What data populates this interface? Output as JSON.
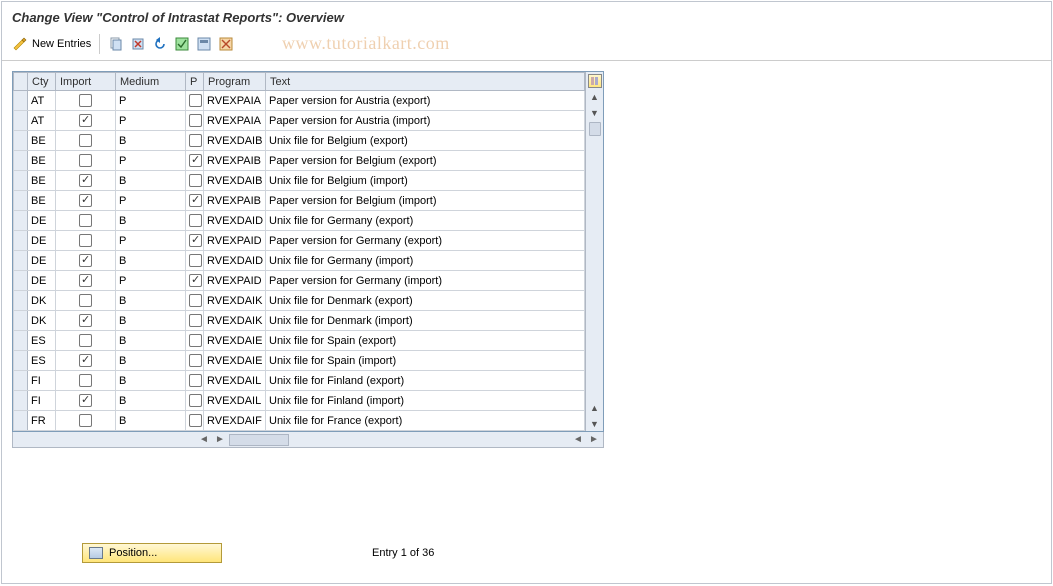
{
  "title": "Change View \"Control of Intrastat Reports\": Overview",
  "watermark": "www.tutorialkart.com",
  "toolbar": {
    "new_entries_label": "New Entries"
  },
  "columns": {
    "cty": "Cty",
    "import": "Import",
    "medium": "Medium",
    "p": "P",
    "program": "Program",
    "text": "Text"
  },
  "rows": [
    {
      "cty": "AT",
      "import": false,
      "medium": "P",
      "p": false,
      "program": "RVEXPAIA",
      "text": "Paper version for Austria (export)"
    },
    {
      "cty": "AT",
      "import": true,
      "medium": "P",
      "p": false,
      "program": "RVEXPAIA",
      "text": "Paper version for Austria (import)"
    },
    {
      "cty": "BE",
      "import": false,
      "medium": "B",
      "p": false,
      "program": "RVEXDAIB",
      "text": "Unix file for Belgium (export)"
    },
    {
      "cty": "BE",
      "import": false,
      "medium": "P",
      "p": true,
      "program": "RVEXPAIB",
      "text": "Paper version for Belgium (export)"
    },
    {
      "cty": "BE",
      "import": true,
      "medium": "B",
      "p": false,
      "program": "RVEXDAIB",
      "text": "Unix file for Belgium (import)"
    },
    {
      "cty": "BE",
      "import": true,
      "medium": "P",
      "p": true,
      "program": "RVEXPAIB",
      "text": "Paper version for Belgium (import)"
    },
    {
      "cty": "DE",
      "import": false,
      "medium": "B",
      "p": false,
      "program": "RVEXDAID",
      "text": "Unix file for Germany (export)"
    },
    {
      "cty": "DE",
      "import": false,
      "medium": "P",
      "p": true,
      "program": "RVEXPAID",
      "text": "Paper version for Germany (export)"
    },
    {
      "cty": "DE",
      "import": true,
      "medium": "B",
      "p": false,
      "program": "RVEXDAID",
      "text": "Unix file for Germany (import)"
    },
    {
      "cty": "DE",
      "import": true,
      "medium": "P",
      "p": true,
      "program": "RVEXPAID",
      "text": "Paper version for Germany (import)"
    },
    {
      "cty": "DK",
      "import": false,
      "medium": "B",
      "p": false,
      "program": "RVEXDAIK",
      "text": "Unix file for Denmark (export)"
    },
    {
      "cty": "DK",
      "import": true,
      "medium": "B",
      "p": false,
      "program": "RVEXDAIK",
      "text": "Unix file for Denmark (import)"
    },
    {
      "cty": "ES",
      "import": false,
      "medium": "B",
      "p": false,
      "program": "RVEXDAIE",
      "text": "Unix file for Spain (export)"
    },
    {
      "cty": "ES",
      "import": true,
      "medium": "B",
      "p": false,
      "program": "RVEXDAIE",
      "text": "Unix file for Spain (import)"
    },
    {
      "cty": "FI",
      "import": false,
      "medium": "B",
      "p": false,
      "program": "RVEXDAIL",
      "text": "Unix file for Finland (export)"
    },
    {
      "cty": "FI",
      "import": true,
      "medium": "B",
      "p": false,
      "program": "RVEXDAIL",
      "text": "Unix file for Finland (import)"
    },
    {
      "cty": "FR",
      "import": false,
      "medium": "B",
      "p": false,
      "program": "RVEXDAIF",
      "text": "Unix file for France (export)"
    }
  ],
  "footer": {
    "position_label": "Position...",
    "entry_status": "Entry 1 of 36"
  }
}
